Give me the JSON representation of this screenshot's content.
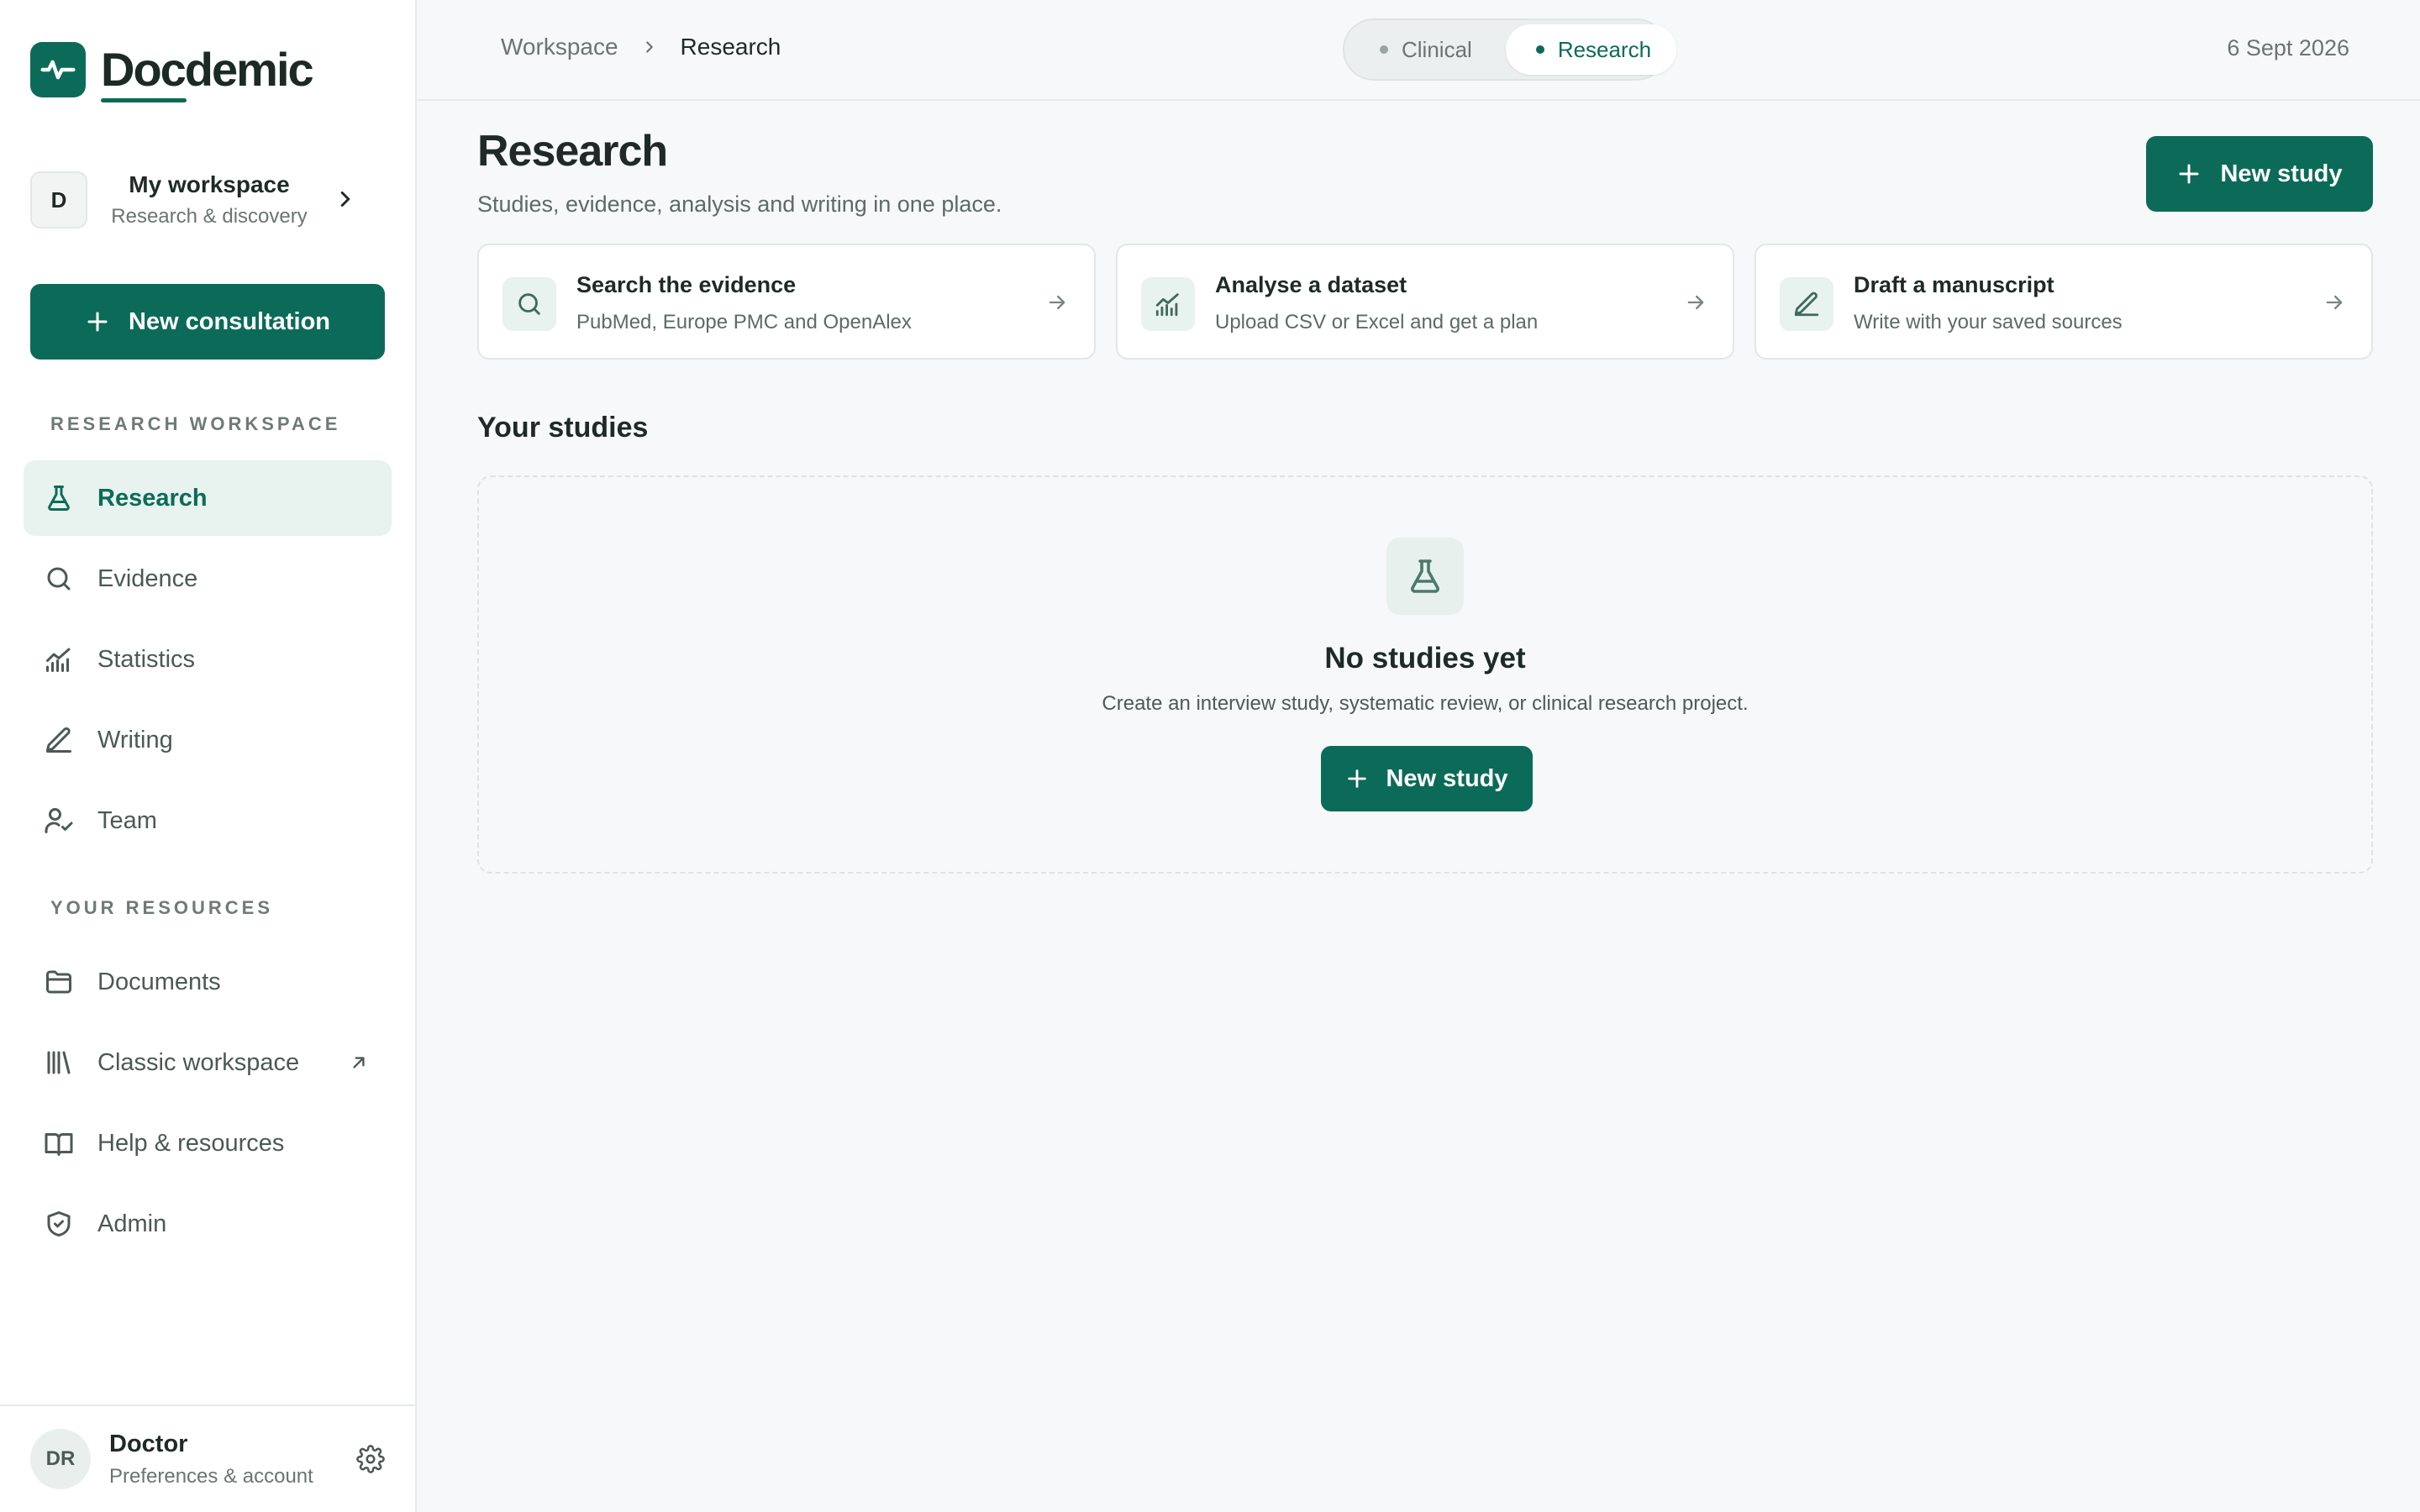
{
  "app": {
    "brand": "Docdemic",
    "colors": {
      "accent": "#0c6b58",
      "accent_soft": "#e8f2ee",
      "background": "#f7f8f9",
      "text": "#1f2a27",
      "muted": "#6a7572"
    }
  },
  "sidebar": {
    "workspace": {
      "avatar_letter": "D",
      "name": "My workspace",
      "subtitle": "Research & discovery",
      "icon": "chevron-right-icon"
    },
    "new_consultation_label": "New consultation",
    "research_section_label": "RESEARCH WORKSPACE",
    "research_items": [
      {
        "label": "Research",
        "icon": "flask-icon",
        "active": true
      },
      {
        "label": "Evidence",
        "icon": "search-icon",
        "active": false
      },
      {
        "label": "Statistics",
        "icon": "chart-icon",
        "active": false
      },
      {
        "label": "Writing",
        "icon": "pen-icon",
        "active": false
      },
      {
        "label": "Team",
        "icon": "user-check-icon",
        "active": false
      }
    ],
    "resources_section_label": "YOUR RESOURCES",
    "resource_items": [
      {
        "label": "Documents",
        "icon": "folder-icon"
      },
      {
        "label": "Classic workspace",
        "icon": "library-icon",
        "external": true
      },
      {
        "label": "Help & resources",
        "icon": "book-icon"
      },
      {
        "label": "Admin",
        "icon": "shield-icon"
      }
    ],
    "user": {
      "initials": "DR",
      "name": "Doctor",
      "subtitle": "Preferences & account",
      "icon": "gear-icon"
    }
  },
  "topbar": {
    "breadcrumb": {
      "parent": "Workspace",
      "current": "Research"
    },
    "modes": [
      {
        "label": "Clinical",
        "active": false
      },
      {
        "label": "Research",
        "active": true
      }
    ],
    "date": "6 Sept 2026"
  },
  "main": {
    "title": "Research",
    "subtitle": "Studies, evidence, analysis and writing in one place.",
    "new_study_label": "New study",
    "action_cards": [
      {
        "title": "Search the evidence",
        "description": "PubMed, Europe PMC and OpenAlex",
        "icon": "search-icon"
      },
      {
        "title": "Analyse a dataset",
        "description": "Upload CSV or Excel and get a plan",
        "icon": "chart-icon"
      },
      {
        "title": "Draft a manuscript",
        "description": "Write with your saved sources",
        "icon": "pen-icon"
      }
    ],
    "studies_title": "Your studies",
    "empty_state": {
      "icon": "flask-icon",
      "title": "No studies yet",
      "description": "Create an interview study, systematic review, or clinical research project.",
      "button_label": "New study"
    }
  }
}
